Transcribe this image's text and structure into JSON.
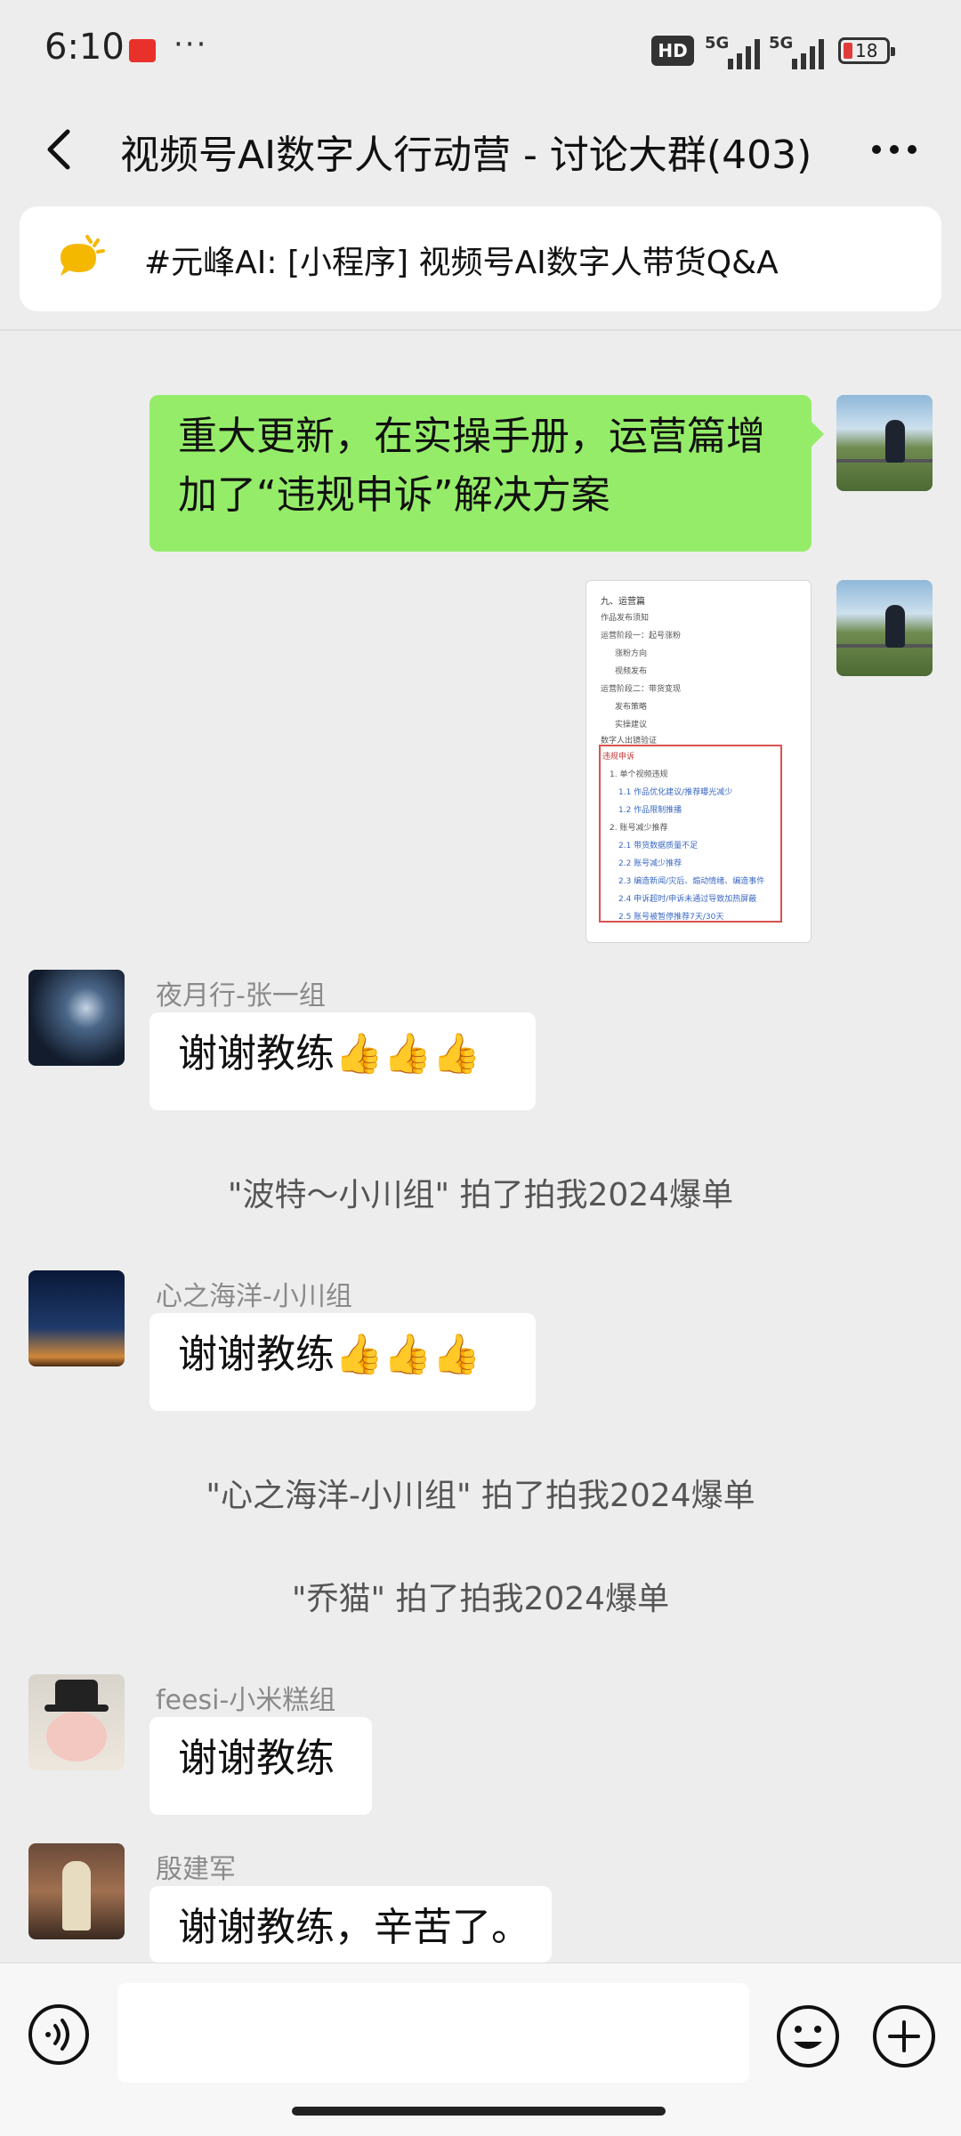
{
  "status_bar": {
    "time": "6:10",
    "dots": "···",
    "hd_label": "HD",
    "network_1": "5G",
    "network_2": "5G",
    "battery": "18"
  },
  "header": {
    "title": "视频号AI数字人行动营 - 讨论大群(403)"
  },
  "pinned": {
    "text": "#元峰AI: [小程序] 视频号AI数字人带货Q&A"
  },
  "messages": {
    "m1_text": "重大更新，在实操手册，运营篇增加了“违规申诉”解决方案",
    "image_doc": {
      "lines": [
        "九、运营篇",
        "作品发布须知",
        "运营阶段一：起号涨粉",
        "涨粉方向",
        "视频发布",
        "运营阶段二：带货变现",
        "发布策略",
        "实操建议",
        "数字人出镜验证",
        "违规申诉",
        "1. 单个视频违规",
        "1.1 作品优化建议/推荐曝光减少",
        "1.2 作品限制推播",
        "2. 账号减少推荐",
        "2.1 带货数据质量不足",
        "2.2 账号减少推荐",
        "2.3 编造新闻/灾后、煽动情绪、编造事件",
        "2.4 申诉超时/申诉未通过导致加热屏蔽",
        "2.5 账号被暂停推荐7天/30天"
      ]
    },
    "m3": {
      "sender": "夜月行-张一组",
      "text": "谢谢教练👍👍👍"
    },
    "sys1": "\"波特～小川组\" 拍了拍我2024爆单",
    "m4": {
      "sender": "心之海洋-小川组",
      "text": "谢谢教练👍👍👍"
    },
    "sys2": "\"心之海洋-小川组\" 拍了拍我2024爆单",
    "sys3": "\"乔猫\" 拍了拍我2024爆单",
    "m5": {
      "sender": "feesi-小米糕组",
      "text": "谢谢教练"
    },
    "m6": {
      "sender": "殷建军",
      "text": "谢谢教练，辛苦了。"
    }
  },
  "input": {
    "value": "",
    "placeholder": ""
  },
  "icons": {
    "back": "back-arrow-icon",
    "more": "more-icon",
    "pinned": "chat-bubble-icon",
    "voice": "voice-icon",
    "emoji": "emoji-icon",
    "plus": "plus-icon"
  },
  "colors": {
    "background": "#ededed",
    "bubble_self": "#95ec69",
    "bubble_other": "#ffffff",
    "pinned_icon": "#f5b800"
  }
}
